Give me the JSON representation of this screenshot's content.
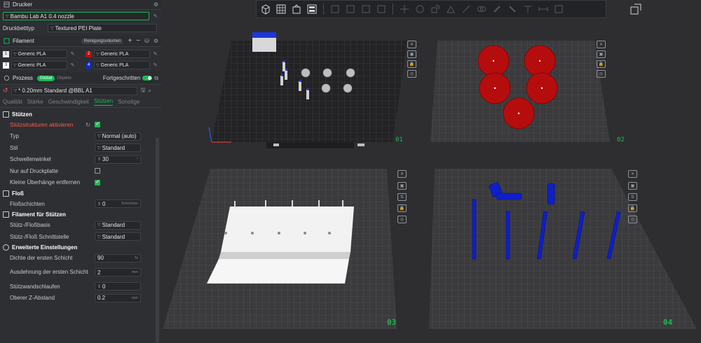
{
  "sidebar": {
    "printer_header": "Drucker",
    "printer_select": "Bambu Lab A1 0.4 nozzle",
    "bed_type_label": "Druckbetttyp",
    "bed_type_value": "Textured PEI Plate",
    "filament_header": "Filament",
    "purge_volume_button": "Reinigungsvolumen",
    "filaments": [
      {
        "num": "1",
        "color": "#e8e8e8",
        "num_text": "#222222",
        "name": "Generic PLA"
      },
      {
        "num": "2",
        "color": "#b01111",
        "num_text": "#ffffff",
        "name": "Generic PLA"
      },
      {
        "num": "3",
        "color": "#ffffff",
        "num_text": "#222222",
        "name": "Generic PLA"
      },
      {
        "num": "4",
        "color": "#1428c8",
        "num_text": "#ffffff",
        "name": "Generic PLA"
      }
    ],
    "process_header": "Prozess",
    "process_global": "Global",
    "process_objects": "Objekte",
    "advanced_label": "Fortgeschritten",
    "process_preset": "* 0.20mm Standard @BBL A1",
    "tabs": [
      {
        "label": "Qualität",
        "active": false
      },
      {
        "label": "Stärke",
        "active": false
      },
      {
        "label": "Geschwindigkeit",
        "active": false
      },
      {
        "label": "Stützen",
        "active": true
      },
      {
        "label": "Sonstige",
        "active": false
      }
    ],
    "groups": {
      "supports": {
        "title": "Stützen",
        "enable_label": "Stützstrukturen aktivieren",
        "type_label": "Typ",
        "type_value": "Normal (auto)",
        "style_label": "Stil",
        "style_value": "Standard",
        "threshold_label": "Schwellenwinkel",
        "threshold_value": "30",
        "threshold_unit": "°",
        "only_plate_label": "Nur auf Druckplatte",
        "remove_small_label": "Kleine Überhänge entfernen"
      },
      "raft": {
        "title": "Floß",
        "layers_label": "Floßschichten",
        "layers_value": "0",
        "layers_unit": "Schichten"
      },
      "support_filament": {
        "title": "Filament für Stützen",
        "base_label": "Stütz-/Floßbasis",
        "base_value": "Standard",
        "interface_label": "Stütz-/Floß Schnittstelle",
        "interface_value": "Standard"
      },
      "advanced": {
        "title": "Erweiterte Einstellungen",
        "first_density_label": "Dichte der ersten Schicht",
        "first_density_value": "90",
        "first_density_unit": "%",
        "first_expansion_label": "Ausdehnung der ersten Schicht",
        "first_expansion_value": "2",
        "first_expansion_unit": "mm",
        "wall_loops_label": "Stützwandschlaufen",
        "wall_loops_value": "0",
        "top_z_label": "Oberer Z-Abstand",
        "top_z_value": "0.2",
        "top_z_unit": "mm"
      }
    }
  },
  "viewport": {
    "plates": [
      {
        "number": "01"
      },
      {
        "number": "02"
      },
      {
        "number": "03"
      },
      {
        "number": "04"
      }
    ]
  }
}
